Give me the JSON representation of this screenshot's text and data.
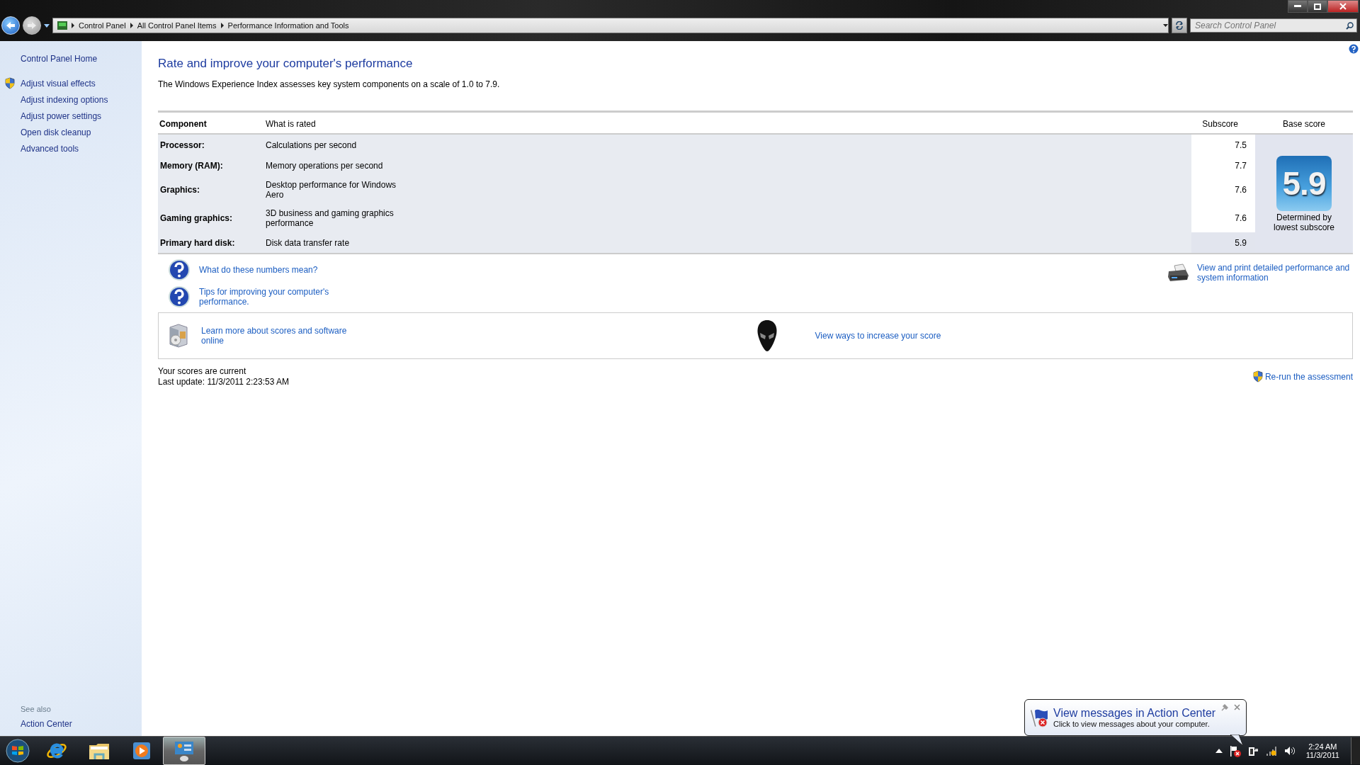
{
  "address_bar": {
    "breadcrumbs": [
      "Control Panel",
      "All Control Panel Items",
      "Performance Information and Tools"
    ]
  },
  "search": {
    "placeholder": "Search Control Panel"
  },
  "sidebar": {
    "home": "Control Panel Home",
    "items": [
      {
        "label": "Adjust visual effects",
        "shield": true
      },
      {
        "label": "Adjust indexing options",
        "shield": false
      },
      {
        "label": "Adjust power settings",
        "shield": false
      },
      {
        "label": "Open disk cleanup",
        "shield": false
      },
      {
        "label": "Advanced tools",
        "shield": false
      }
    ],
    "see_also_heading": "See also",
    "see_also": [
      "Action Center"
    ]
  },
  "page": {
    "title": "Rate and improve your computer's performance",
    "description": "The Windows Experience Index assesses key system components on a scale of 1.0 to 7.9."
  },
  "table": {
    "columns": [
      "Component",
      "What is rated",
      "Subscore",
      "Base score"
    ],
    "rows": [
      {
        "component": "Processor:",
        "rated": "Calculations per second",
        "subscore": "7.5",
        "lowest": false
      },
      {
        "component": "Memory (RAM):",
        "rated": "Memory operations per second",
        "subscore": "7.7",
        "lowest": false
      },
      {
        "component": "Graphics:",
        "rated": "Desktop performance for Windows Aero",
        "subscore": "7.6",
        "lowest": false
      },
      {
        "component": "Gaming graphics:",
        "rated": "3D business and gaming graphics performance",
        "subscore": "7.6",
        "lowest": false
      },
      {
        "component": "Primary hard disk:",
        "rated": "Disk data transfer rate",
        "subscore": "5.9",
        "lowest": true
      }
    ],
    "base_score": "5.9",
    "base_note": "Determined by lowest subscore"
  },
  "help_links": [
    "What do these numbers mean?",
    "Tips for improving your computer's performance."
  ],
  "print_link": "View and print detailed performance and system information",
  "box_links": [
    {
      "kind": "software",
      "label": "Learn more about scores and software online"
    },
    {
      "kind": "alien",
      "label": "View ways to increase your score"
    }
  ],
  "status": [
    "Your scores are current",
    "Last update: 11/3/2011 2:23:53 AM"
  ],
  "rerun": "Re-run the assessment",
  "taskbar": {
    "apps": [
      {
        "kind": "ie",
        "selected": false
      },
      {
        "kind": "explorer",
        "selected": false
      },
      {
        "kind": "media",
        "selected": false
      },
      {
        "kind": "control-panel",
        "selected": true
      }
    ],
    "time": "2:24 AM",
    "date": "11/3/2011"
  },
  "notification": {
    "title": "View messages in Action Center",
    "text": "Click to view messages about your computer."
  }
}
